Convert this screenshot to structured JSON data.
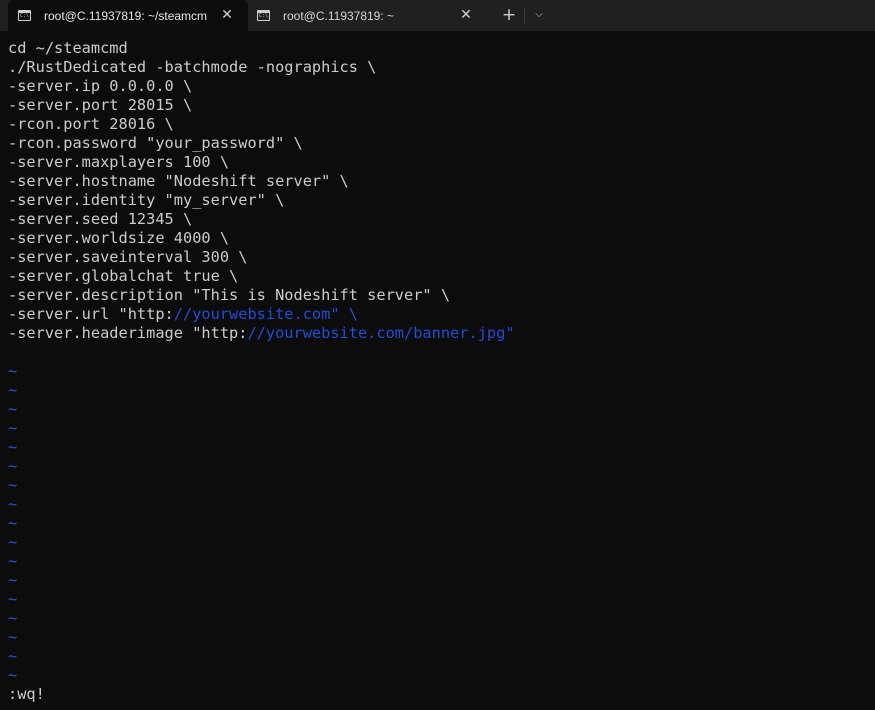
{
  "tabs": [
    {
      "label": "root@C.11937819: ~/steamcm",
      "active": true
    },
    {
      "label": "root@C.11937819: ~",
      "active": false
    }
  ],
  "tab_close_glyph": "✕",
  "new_tab_glyph": "+",
  "dropdown_glyph": "⌵",
  "icons": {
    "tab": "terminal-icon",
    "close": "close-icon",
    "new_tab": "plus-icon",
    "dropdown": "chevron-down-icon"
  },
  "colors": {
    "background": "#0c0c0c",
    "text": "#cccccc",
    "url": "#1f4fd8",
    "tilde": "#2d52dc",
    "titlebar": "#202020"
  },
  "editor": {
    "lines": [
      {
        "pre": "cd ~/steamcmd",
        "url": "",
        "post": ""
      },
      {
        "pre": "./RustDedicated -batchmode -nographics \\",
        "url": "",
        "post": ""
      },
      {
        "pre": "-server.ip 0.0.0.0 \\",
        "url": "",
        "post": ""
      },
      {
        "pre": "-server.port 28015 \\",
        "url": "",
        "post": ""
      },
      {
        "pre": "-rcon.port 28016 \\",
        "url": "",
        "post": ""
      },
      {
        "pre": "-rcon.password \"your_password\" \\",
        "url": "",
        "post": ""
      },
      {
        "pre": "-server.maxplayers 100 \\",
        "url": "",
        "post": ""
      },
      {
        "pre": "-server.hostname \"Nodeshift server\" \\",
        "url": "",
        "post": ""
      },
      {
        "pre": "-server.identity \"my_server\" \\",
        "url": "",
        "post": ""
      },
      {
        "pre": "-server.seed 12345 \\",
        "url": "",
        "post": ""
      },
      {
        "pre": "-server.worldsize 4000 \\",
        "url": "",
        "post": ""
      },
      {
        "pre": "-server.saveinterval 300 \\",
        "url": "",
        "post": ""
      },
      {
        "pre": "-server.globalchat true \\",
        "url": "",
        "post": ""
      },
      {
        "pre": "-server.description \"This is Nodeshift server\" \\",
        "url": "",
        "post": ""
      },
      {
        "pre": "-server.url \"http:",
        "url": "//yourwebsite.com\" \\",
        "post": ""
      },
      {
        "pre": "-server.headerimage \"http:",
        "url": "//yourwebsite.com/banner.jpg\"",
        "post": ""
      }
    ],
    "tildes": [
      "~",
      "~",
      "~",
      "~",
      "~",
      "~",
      "~",
      "~",
      "~",
      "~",
      "~",
      "~",
      "~",
      "~",
      "~",
      "~",
      "~"
    ],
    "command_line": ":wq!"
  }
}
